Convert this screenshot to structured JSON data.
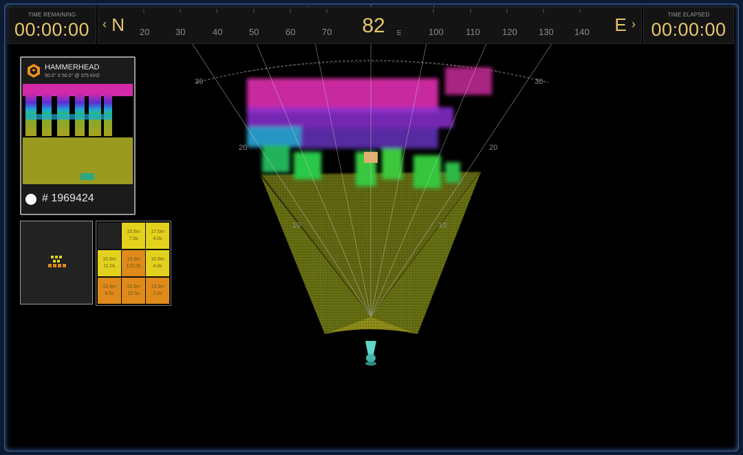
{
  "time_remaining": {
    "label": "TIME REMAINING",
    "value": "00:00:00"
  },
  "time_elapsed": {
    "label": "TIME ELAPSED",
    "value": "00:00:00"
  },
  "compass": {
    "left_dir": "N",
    "right_dir": "E",
    "heading": "82",
    "east_mark": "E",
    "ticks": [
      "20",
      "30",
      "40",
      "50",
      "60",
      "70",
      "100",
      "110",
      "120",
      "130",
      "140"
    ]
  },
  "sonar": {
    "range_labels": [
      "30",
      "30",
      "20",
      "20",
      "10",
      "10"
    ]
  },
  "target": {
    "name": "HAMMERHEAD",
    "spec": "50.0° X 50.0° @ 375 KHZ",
    "id": "# 1969424"
  },
  "grid": {
    "cells": [
      {
        "range": "",
        "time": "",
        "color": "#222222"
      },
      {
        "range": "15.5m",
        "time": "7.0s",
        "color": "#e3d21d"
      },
      {
        "range": "17.0m",
        "time": "4.0s",
        "color": "#e3d21d"
      },
      {
        "range": "15.6m",
        "time": "11.0s",
        "color": "#e3d21d"
      },
      {
        "range": "13.3m",
        "time": "122.0s",
        "color": "#e08a1c"
      },
      {
        "range": "10.9m",
        "time": "4.0s",
        "color": "#e3d21d"
      },
      {
        "range": "12.4m",
        "time": "8.5s",
        "color": "#e08a1c"
      },
      {
        "range": "12.3m",
        "time": "10.5s",
        "color": "#e08a1c"
      },
      {
        "range": "13.3m",
        "time": "2.0s",
        "color": "#e08a1c"
      }
    ]
  },
  "colors": {
    "accent": "#e8c66a",
    "frame": "#3c5a86"
  }
}
